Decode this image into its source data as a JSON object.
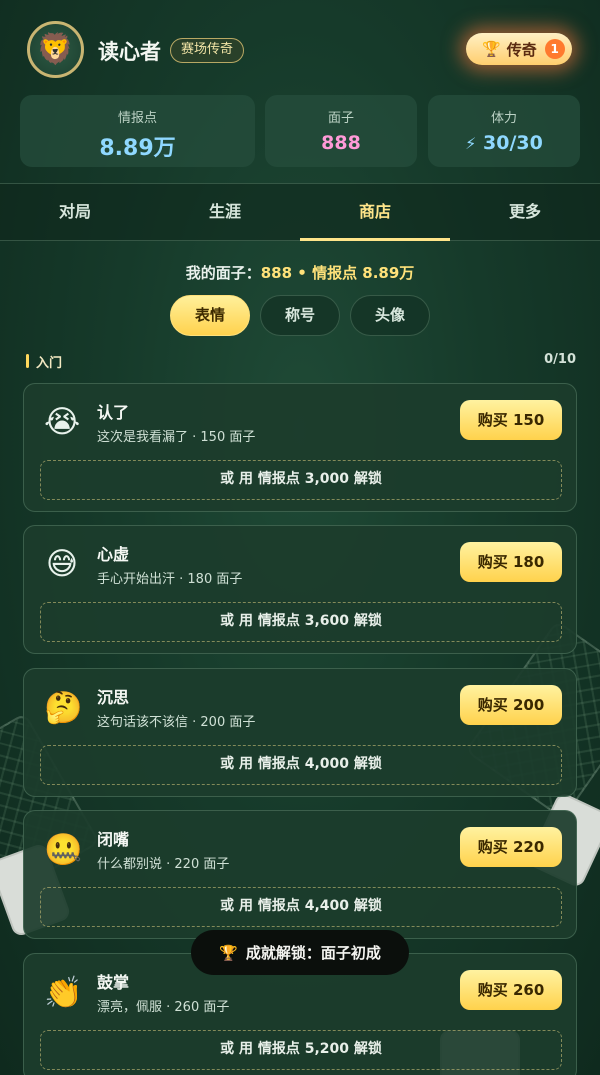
{
  "header": {
    "avatar_emoji": "🦁",
    "username": "读心者",
    "title_badge": "赛场传奇",
    "rank": {
      "icon": "🏆",
      "label": "传奇",
      "level": "1"
    }
  },
  "stats": [
    {
      "label": "情报点",
      "value": "8.89万",
      "color": "#8fd8ff"
    },
    {
      "label": "面子",
      "value": "888",
      "color": "#ff9ad8"
    },
    {
      "label": "体力",
      "icon": "⚡",
      "value": "30/30",
      "color": "#8fd8ff"
    }
  ],
  "tabs": [
    "对局",
    "生涯",
    "商店",
    "更多"
  ],
  "active_tab": "商店",
  "balance": {
    "prefix": "我的面子：",
    "face": "888",
    "sep": " • ",
    "intel": "情报点 8.89万"
  },
  "subtabs": [
    "表情",
    "称号",
    "头像"
  ],
  "active_subtab": "表情",
  "section": {
    "name": "入门",
    "count": "0/10"
  },
  "items": [
    {
      "emoji": "😭",
      "name": "认了",
      "desc": "这次是我看漏了 · 150 面子",
      "buy": "购买 150",
      "alt": "或 用 情报点 3,000 解锁"
    },
    {
      "emoji": "😅",
      "name": "心虚",
      "desc": "手心开始出汗 · 180 面子",
      "buy": "购买 180",
      "alt": "或 用 情报点 3,600 解锁"
    },
    {
      "emoji": "🤔",
      "name": "沉思",
      "desc": "这句话该不该信 · 200 面子",
      "buy": "购买 200",
      "alt": "或 用 情报点 4,000 解锁"
    },
    {
      "emoji": "🤐",
      "name": "闭嘴",
      "desc": "什么都别说 · 220 面子",
      "buy": "购买 220",
      "alt": "或 用 情报点 4,400 解锁"
    },
    {
      "emoji": "👏",
      "name": "鼓掌",
      "desc": "漂亮，佩服 · 260 面子",
      "buy": "购买 260",
      "alt": "或 用 情报点 5,200 解锁"
    }
  ],
  "toast": {
    "icon": "🏆",
    "text": "成就解锁：面子初成"
  },
  "colors": {
    "accent": "#ffd24c",
    "background": "#163a2a"
  }
}
